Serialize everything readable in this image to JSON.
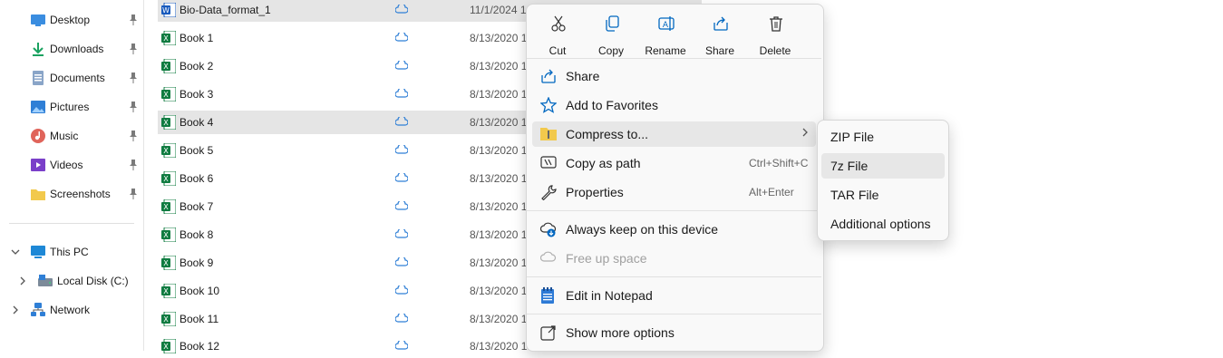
{
  "sidebar": {
    "quick_access": [
      {
        "label": "Desktop",
        "icon": "desktop-icon"
      },
      {
        "label": "Downloads",
        "icon": "downloads-icon"
      },
      {
        "label": "Documents",
        "icon": "documents-icon"
      },
      {
        "label": "Pictures",
        "icon": "pictures-icon"
      },
      {
        "label": "Music",
        "icon": "music-icon"
      },
      {
        "label": "Videos",
        "icon": "videos-icon"
      },
      {
        "label": "Screenshots",
        "icon": "folder-icon"
      }
    ],
    "this_pc": "This PC",
    "local_disk": "Local Disk (C:)",
    "network": "Network"
  },
  "files": [
    {
      "name": "Bio-Data_format_1",
      "date": "11/1/2024 10",
      "type": "word"
    },
    {
      "name": "Book 1",
      "date": "8/13/2020 1:",
      "type": "excel"
    },
    {
      "name": "Book 2",
      "date": "8/13/2020 1:",
      "type": "excel"
    },
    {
      "name": "Book 3",
      "date": "8/13/2020 1:",
      "type": "excel"
    },
    {
      "name": "Book 4",
      "date": "8/13/2020 1:",
      "type": "excel"
    },
    {
      "name": "Book 5",
      "date": "8/13/2020 1:",
      "type": "excel"
    },
    {
      "name": "Book 6",
      "date": "8/13/2020 1:",
      "type": "excel"
    },
    {
      "name": "Book 7",
      "date": "8/13/2020 1:",
      "type": "excel"
    },
    {
      "name": "Book 8",
      "date": "8/13/2020 1:",
      "type": "excel"
    },
    {
      "name": "Book 9",
      "date": "8/13/2020 1:",
      "type": "excel"
    },
    {
      "name": "Book 10",
      "date": "8/13/2020 1:",
      "type": "excel"
    },
    {
      "name": "Book 11",
      "date": "8/13/2020 1:",
      "type": "excel"
    },
    {
      "name": "Book 12",
      "date": "8/13/2020 1:",
      "type": "excel"
    }
  ],
  "context_menu": {
    "quick_actions": [
      "Cut",
      "Copy",
      "Rename",
      "Share",
      "Delete"
    ],
    "items": {
      "share": "Share",
      "favorites": "Add to Favorites",
      "compress": "Compress to...",
      "copy_path": "Copy as path",
      "copy_path_shortcut": "Ctrl+Shift+C",
      "properties": "Properties",
      "properties_shortcut": "Alt+Enter",
      "keep": "Always keep on this device",
      "free": "Free up space",
      "notepad": "Edit in Notepad",
      "more": "Show more options"
    }
  },
  "compress_submenu": [
    "ZIP File",
    "7z File",
    "TAR File",
    "Additional options"
  ],
  "colors": {
    "accent": "#0067c0",
    "excel_green": "#107c41",
    "word_blue": "#185abd",
    "selection": "#cce8ff",
    "menu_bg": "#f9f9f9"
  }
}
